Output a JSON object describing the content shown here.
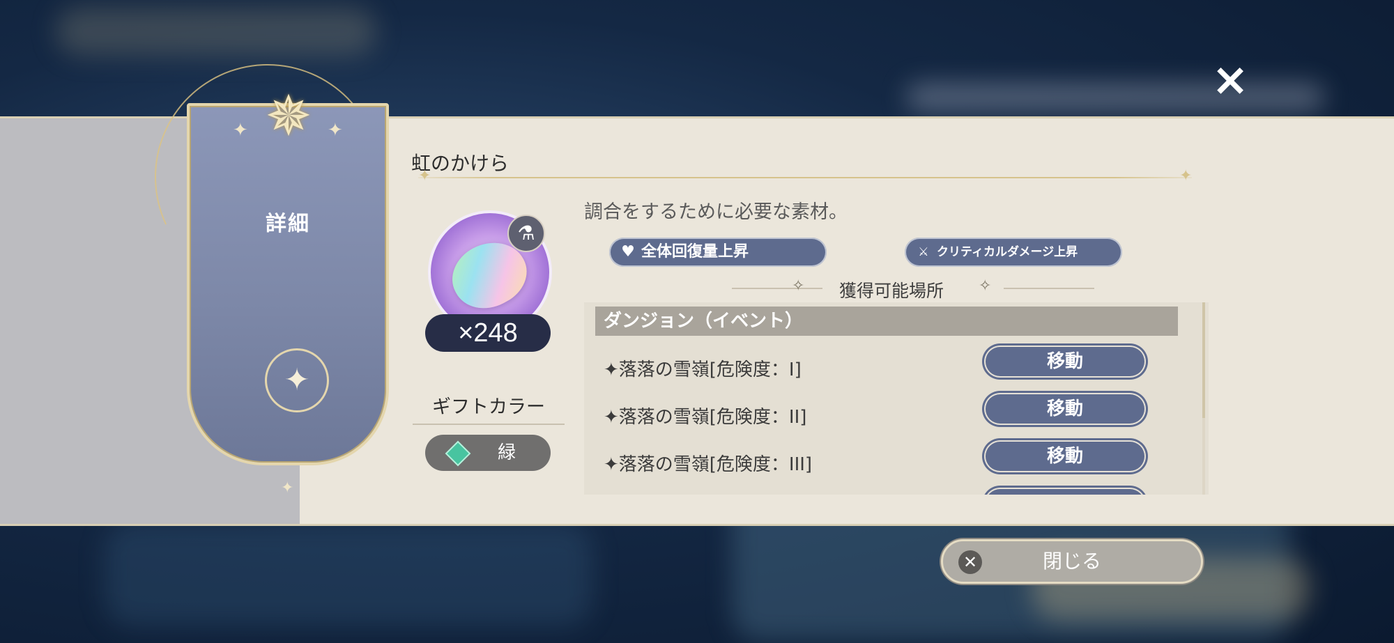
{
  "dialog": {
    "close_icon": "×",
    "banner_title": "詳細",
    "item_name": "虹のかけら",
    "quantity": "×248",
    "description": "調合をするために必要な素材。",
    "gift_color_label": "ギフトカラー",
    "gift_color_value": "緑",
    "tags": [
      {
        "label": "全体回復量上昇",
        "icon": "heart-sparkle-icon"
      },
      {
        "label": "クリティカルダメージ上昇",
        "icon": "sword-sparkle-icon"
      }
    ],
    "acquire_title": "獲得可能場所",
    "acquire_list": {
      "header": "ダンジョン（イベント）",
      "rows": [
        {
          "label": "✦落落の雪嶺[危険度：I]",
          "button": "移動"
        },
        {
          "label": "✦落落の雪嶺[危険度：II]",
          "button": "移動"
        },
        {
          "label": "✦落落の雪嶺[危険度：III]",
          "button": "移動"
        }
      ]
    },
    "close_button_label": "閉じる",
    "close_button_icon": "✕"
  },
  "colors": {
    "panel_bg": "#ebe6db",
    "button_navy": "#5e6b8e",
    "gold_trim": "#e4d6ad",
    "gift_green": "#48c4a0"
  }
}
